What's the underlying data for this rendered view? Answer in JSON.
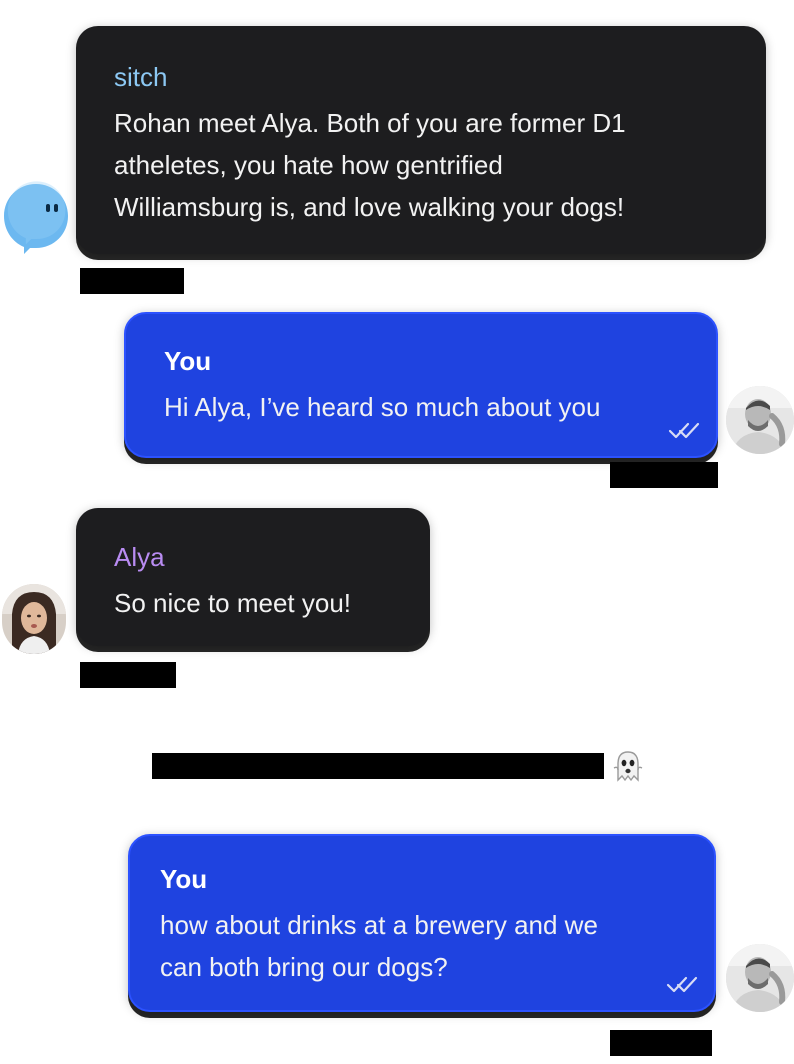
{
  "messages": [
    {
      "sender": "sitch",
      "text": "Rohan meet Alya. Both of you are former D1 atheletes, you hate how gentrified Williamsburg is, and love walking your dogs!",
      "line1": "Rohan meet Alya. Both of you are former D1",
      "line2": "atheletes, you hate how gentrified",
      "line3": "Williamsburg is, and love walking your dogs!"
    },
    {
      "sender": "You",
      "text": "Hi Alya, I’ve heard so much about you",
      "status_icon": "double-check-icon"
    },
    {
      "sender": "Alya",
      "text": "So nice to meet you!"
    },
    {
      "sender": "You",
      "text": "how about drinks at a brewery and we can both bring our dogs?",
      "line1": "how about drinks at a brewery and we",
      "line2": "can both bring our dogs?",
      "status_icon": "double-check-icon"
    }
  ],
  "system_note": {
    "icon": "ghost-icon"
  },
  "colors": {
    "sitch_name": "#8cc8f3",
    "alya_name": "#b98cf2",
    "dark_bubble": "#1d1d1f",
    "blue_bubble": "#1f43e0",
    "sitch_avatar": "#6cb8f0"
  }
}
